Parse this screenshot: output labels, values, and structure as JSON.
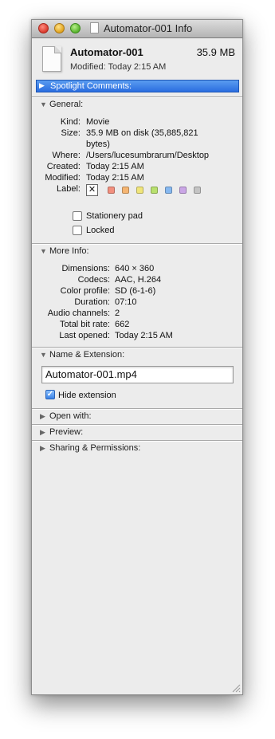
{
  "window": {
    "title": "Automator-001 Info"
  },
  "header": {
    "file_name": "Automator-001",
    "file_size": "35.9 MB",
    "modified": "Modified: Today 2:15 AM"
  },
  "spotlight": {
    "label": "Spotlight Comments:"
  },
  "general": {
    "title": "General:",
    "kind_key": "Kind:",
    "kind": "Movie",
    "size_key": "Size:",
    "size_line1": "35.9 MB on disk (35,885,821",
    "size_line2": "bytes)",
    "where_key": "Where:",
    "where": "/Users/lucesumbrarum/Desktop",
    "created_key": "Created:",
    "created": "Today 2:15 AM",
    "modified_key": "Modified:",
    "modified": "Today 2:15 AM",
    "label_key": "Label:",
    "label_none": "✕",
    "label_colors": [
      "#f28f7e",
      "#f5b572",
      "#f0e57a",
      "#b8e06e",
      "#86b8f0",
      "#caa6e6",
      "#c4c4c4"
    ],
    "stationery_label": "Stationery pad",
    "locked_label": "Locked"
  },
  "more_info": {
    "title": "More Info:",
    "dimensions_key": "Dimensions:",
    "dimensions": "640 × 360",
    "codecs_key": "Codecs:",
    "codecs": "AAC, H.264",
    "color_profile_key": "Color profile:",
    "color_profile": "SD (6-1-6)",
    "duration_key": "Duration:",
    "duration": "07:10",
    "audio_channels_key": "Audio channels:",
    "audio_channels": "2",
    "bit_rate_key": "Total bit rate:",
    "bit_rate": "662",
    "last_opened_key": "Last opened:",
    "last_opened": "Today 2:15 AM"
  },
  "name_extension": {
    "title": "Name & Extension:",
    "name_value": "Automator-001.mp4",
    "hide_extension_label": "Hide extension"
  },
  "collapsed_sections": {
    "open_with": "Open with:",
    "preview": "Preview:",
    "sharing": "Sharing & Permissions:"
  }
}
